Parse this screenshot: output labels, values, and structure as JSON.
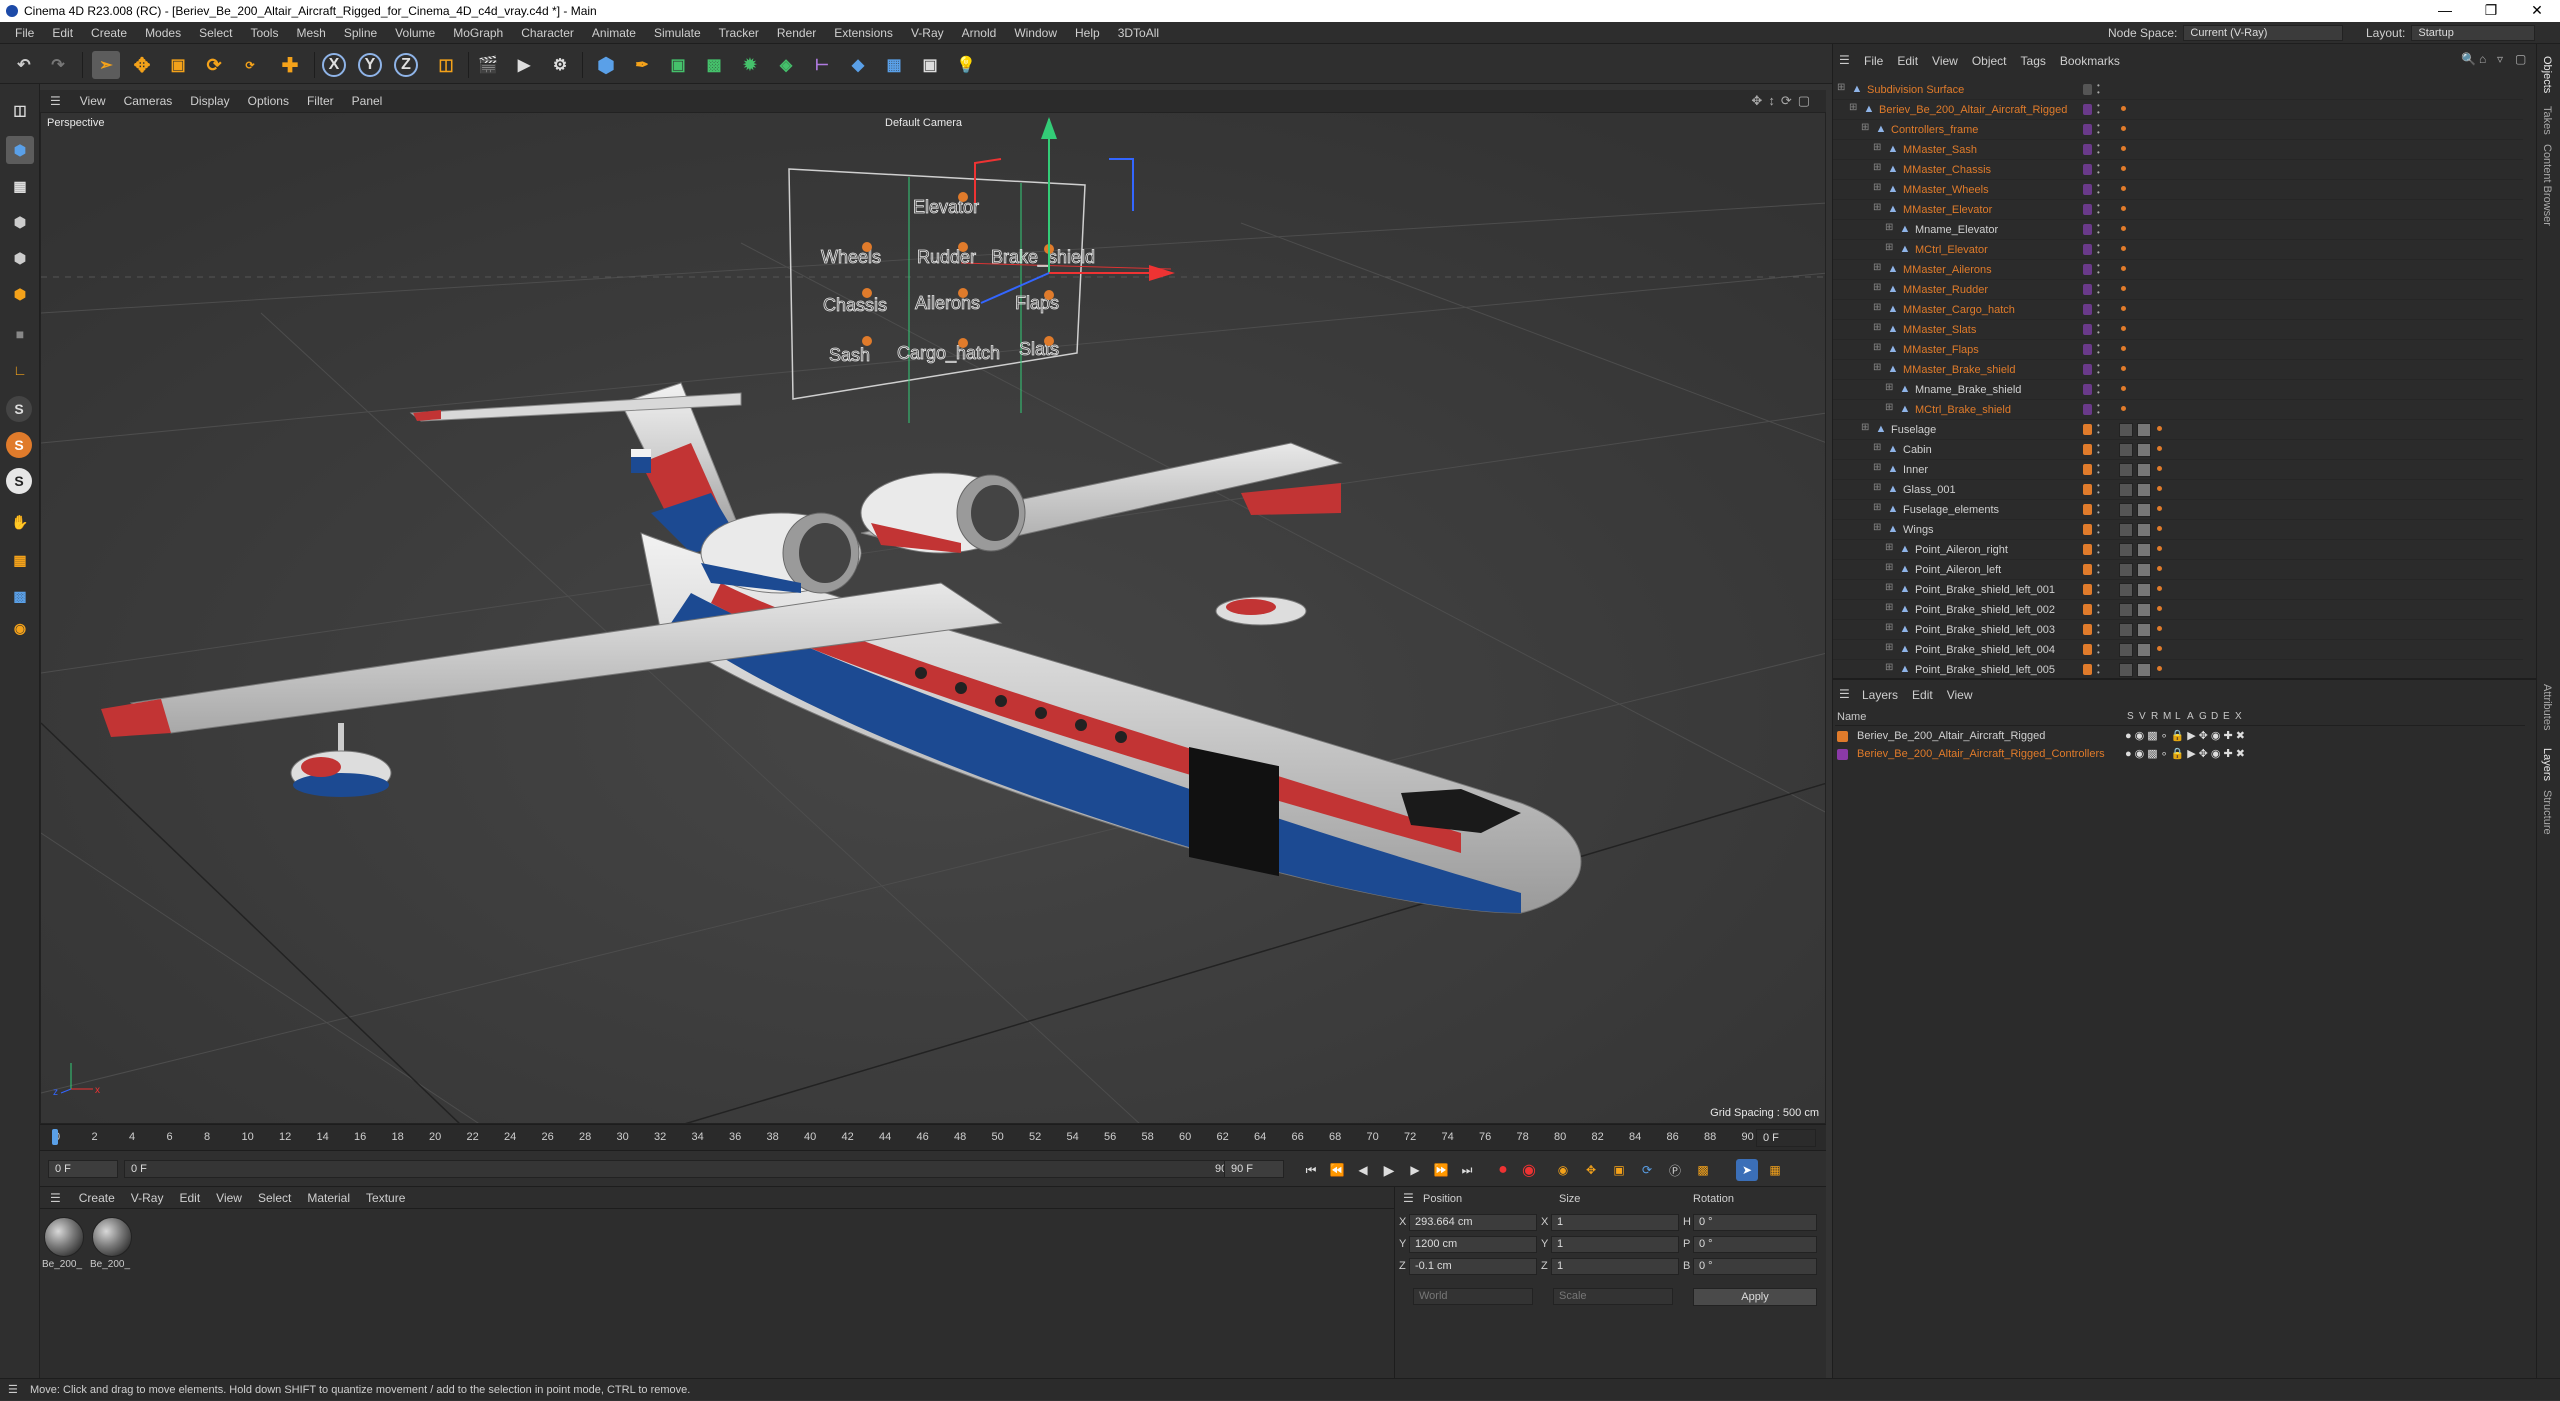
{
  "window": {
    "title": "Cinema 4D R23.008 (RC) - [Beriev_Be_200_Altair_Aircraft_Rigged_for_Cinema_4D_c4d_vray.c4d *] - Main",
    "controls": [
      "—",
      "❐",
      "✕"
    ]
  },
  "menubar": {
    "items": [
      "File",
      "Edit",
      "Create",
      "Modes",
      "Select",
      "Tools",
      "Mesh",
      "Spline",
      "Volume",
      "MoGraph",
      "Character",
      "Animate",
      "Simulate",
      "Tracker",
      "Render",
      "Extensions",
      "V-Ray",
      "Arnold",
      "Window",
      "Help",
      "3DToAll"
    ],
    "node_space_label": "Node Space:",
    "node_space_value": "Current (V-Ray)",
    "layout_label": "Layout:",
    "layout_value": "Startup"
  },
  "toolbar": {
    "axis_x": "X",
    "axis_y": "Y",
    "axis_z": "Z"
  },
  "left_tools": {
    "s1": "S",
    "s2": "S",
    "s3": "S"
  },
  "viewport": {
    "menu": [
      "View",
      "Cameras",
      "Display",
      "Options",
      "Filter",
      "Panel"
    ],
    "view_name": "Perspective",
    "camera": "Default Camera",
    "grid_spacing": "Grid Spacing : 500 cm",
    "controller_labels": [
      "Elevator",
      "Wheels",
      "Rudder",
      "Brake_shield",
      "Chassis",
      "Ailerons",
      "Flaps",
      "Sash",
      "Cargo_hatch",
      "Slats"
    ]
  },
  "timeline": {
    "ticks": [
      "0",
      "2",
      "4",
      "6",
      "8",
      "10",
      "12",
      "14",
      "16",
      "18",
      "20",
      "22",
      "24",
      "26",
      "28",
      "30",
      "32",
      "34",
      "36",
      "38",
      "40",
      "42",
      "44",
      "46",
      "48",
      "50",
      "52",
      "54",
      "56",
      "58",
      "60",
      "62",
      "64",
      "66",
      "68",
      "70",
      "72",
      "74",
      "76",
      "78",
      "80",
      "82",
      "84",
      "86",
      "88",
      "90"
    ],
    "current_frame_right": "0 F"
  },
  "transport": {
    "start": "0 F",
    "current": "0 F",
    "end": "90 F",
    "max": "90 F"
  },
  "material_manager": {
    "menu": [
      "Create",
      "V-Ray",
      "Edit",
      "View",
      "Select",
      "Material",
      "Texture"
    ],
    "materials": [
      "Be_200_",
      "Be_200_"
    ]
  },
  "coordinates": {
    "headers": {
      "position": "Position",
      "size": "Size",
      "rotation": "Rotation"
    },
    "rows": [
      {
        "axis": "X",
        "pos": "293.664 cm",
        "size": "1",
        "rot_label": "H",
        "rot": "0 °"
      },
      {
        "axis": "Y",
        "pos": "1200 cm",
        "size": "1",
        "rot_label": "P",
        "rot": "0 °"
      },
      {
        "axis": "Z",
        "pos": "-0.1 cm",
        "size": "1",
        "rot_label": "B",
        "rot": "0 °"
      }
    ],
    "coord_mode": "World",
    "size_mode": "Scale",
    "apply": "Apply"
  },
  "object_manager": {
    "menu": [
      "File",
      "Edit",
      "View",
      "Object",
      "Tags",
      "Bookmarks"
    ],
    "objects": [
      {
        "name": "Subdivision Surface",
        "indent": 0,
        "color": "#e07b2b",
        "tag": "none"
      },
      {
        "name": "Beriev_Be_200_Altair_Aircraft_Rigged",
        "indent": 1,
        "color": "#e07b2b",
        "tag": "purple"
      },
      {
        "name": "Controllers_frame",
        "indent": 2,
        "color": "#e07b2b",
        "tag": "purple"
      },
      {
        "name": "MMaster_Sash",
        "indent": 3,
        "color": "#e07b2b",
        "tag": "purple"
      },
      {
        "name": "MMaster_Chassis",
        "indent": 3,
        "color": "#e07b2b",
        "tag": "purple"
      },
      {
        "name": "MMaster_Wheels",
        "indent": 3,
        "color": "#e07b2b",
        "tag": "purple"
      },
      {
        "name": "MMaster_Elevator",
        "indent": 3,
        "color": "#e07b2b",
        "tag": "purple"
      },
      {
        "name": "Mname_Elevator",
        "indent": 4,
        "color": "#d0d0d0",
        "tag": "purple"
      },
      {
        "name": "MCtrl_Elevator",
        "indent": 4,
        "color": "#e07b2b",
        "tag": "purple"
      },
      {
        "name": "MMaster_Ailerons",
        "indent": 3,
        "color": "#e07b2b",
        "tag": "purple"
      },
      {
        "name": "MMaster_Rudder",
        "indent": 3,
        "color": "#e07b2b",
        "tag": "purple"
      },
      {
        "name": "MMaster_Cargo_hatch",
        "indent": 3,
        "color": "#e07b2b",
        "tag": "purple"
      },
      {
        "name": "MMaster_Slats",
        "indent": 3,
        "color": "#e07b2b",
        "tag": "purple"
      },
      {
        "name": "MMaster_Flaps",
        "indent": 3,
        "color": "#e07b2b",
        "tag": "purple"
      },
      {
        "name": "MMaster_Brake_shield",
        "indent": 3,
        "color": "#e07b2b",
        "tag": "purple"
      },
      {
        "name": "Mname_Brake_shield",
        "indent": 4,
        "color": "#d0d0d0",
        "tag": "purple"
      },
      {
        "name": "MCtrl_Brake_shield",
        "indent": 4,
        "color": "#e07b2b",
        "tag": "purple"
      },
      {
        "name": "Fuselage",
        "indent": 2,
        "color": "#d0d0d0",
        "tag": "orange"
      },
      {
        "name": "Cabin",
        "indent": 3,
        "color": "#d0d0d0",
        "tag": "orange"
      },
      {
        "name": "Inner",
        "indent": 3,
        "color": "#d0d0d0",
        "tag": "orange"
      },
      {
        "name": "Glass_001",
        "indent": 3,
        "color": "#d0d0d0",
        "tag": "orange"
      },
      {
        "name": "Fuselage_elements",
        "indent": 3,
        "color": "#d0d0d0",
        "tag": "orange"
      },
      {
        "name": "Wings",
        "indent": 3,
        "color": "#d0d0d0",
        "tag": "orange"
      },
      {
        "name": "Point_Aileron_right",
        "indent": 4,
        "color": "#d0d0d0",
        "tag": "orange"
      },
      {
        "name": "Point_Aileron_left",
        "indent": 4,
        "color": "#d0d0d0",
        "tag": "orange"
      },
      {
        "name": "Point_Brake_shield_left_001",
        "indent": 4,
        "color": "#d0d0d0",
        "tag": "orange"
      },
      {
        "name": "Point_Brake_shield_left_002",
        "indent": 4,
        "color": "#d0d0d0",
        "tag": "orange"
      },
      {
        "name": "Point_Brake_shield_left_003",
        "indent": 4,
        "color": "#d0d0d0",
        "tag": "orange"
      },
      {
        "name": "Point_Brake_shield_left_004",
        "indent": 4,
        "color": "#d0d0d0",
        "tag": "orange"
      },
      {
        "name": "Point_Brake_shield_left_005",
        "indent": 4,
        "color": "#d0d0d0",
        "tag": "orange"
      }
    ]
  },
  "layer_manager": {
    "menu": [
      "Layers",
      "Edit",
      "View"
    ],
    "name_header": "Name",
    "col_headers": [
      "S",
      "V",
      "R",
      "M",
      "L",
      "A",
      "G",
      "D",
      "E",
      "X"
    ],
    "layers": [
      {
        "name": "Beriev_Be_200_Altair_Aircraft_Rigged",
        "color": "#e07b2b",
        "text_color": "#d0d0d0"
      },
      {
        "name": "Beriev_Be_200_Altair_Aircraft_Rigged_Controllers",
        "color": "#8b3aa8",
        "text_color": "#e07b2b"
      }
    ]
  },
  "right_tabs": [
    "Objects",
    "Takes",
    "Content Browser",
    "Attributes",
    "Layers",
    "Structure"
  ],
  "statusbar": {
    "text": "Move: Click and drag to move elements. Hold down SHIFT to quantize movement / add to the selection in point mode, CTRL to remove."
  }
}
